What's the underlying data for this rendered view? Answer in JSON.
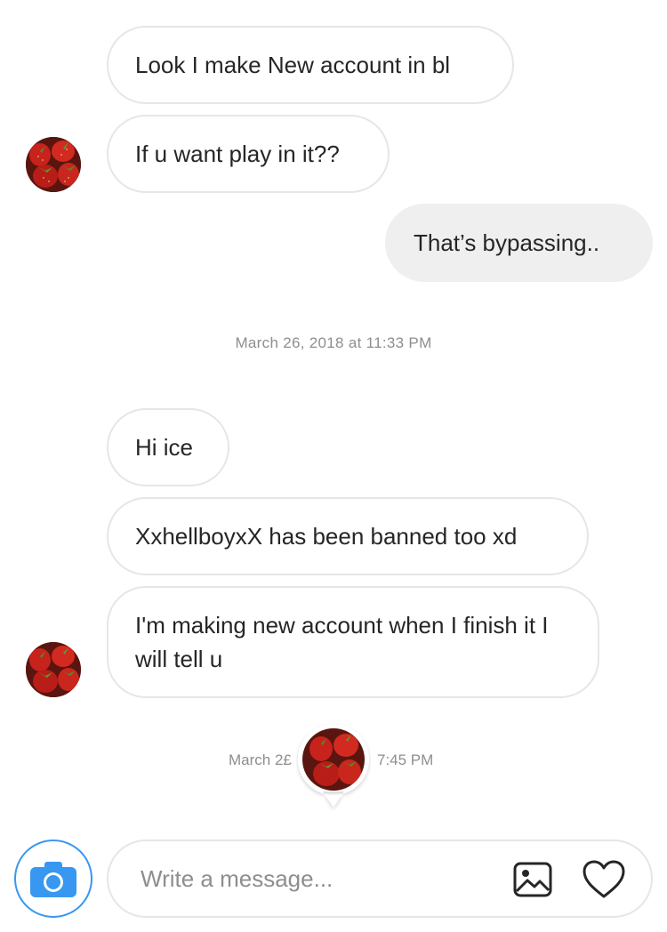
{
  "messages": [
    {
      "text": "Look I make New account in bl"
    },
    {
      "text": "If u want play in it??"
    },
    {
      "text": "That’s bypassing.."
    },
    {
      "text": "Hi ice"
    },
    {
      "text": "XxhellboyxX has been banned too xd"
    },
    {
      "text": "I'm making new account when I finish it I will tell u"
    }
  ],
  "timestamps": [
    {
      "text": "March 26, 2018 at 11:33 PM"
    },
    {
      "left": "March 2£",
      "right": "7:45 PM"
    }
  ],
  "composer": {
    "placeholder": "Write a message..."
  },
  "icons": {
    "camera": "camera-icon",
    "gallery": "image-icon",
    "like": "heart-icon"
  },
  "colors": {
    "accent": "#3897f0",
    "bubble_border": "#e6e6e6",
    "my_bubble": "#efefef",
    "timestamp": "#8e8e8e"
  }
}
